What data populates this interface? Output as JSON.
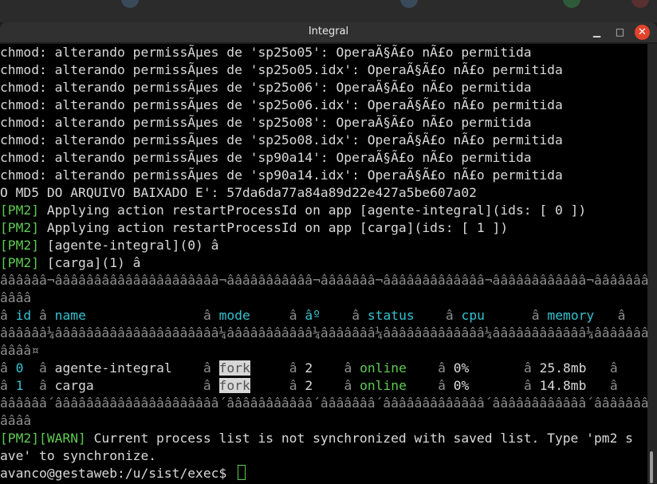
{
  "window": {
    "title": "Integral",
    "minimize": "▁",
    "maximize": "□",
    "close": "✕"
  },
  "chmod_lines": [
    "chmod: alterando permissÃµes de 'sp25o05': OperaÃ§Ã£o nÃ£o permitida",
    "chmod: alterando permissÃµes de 'sp25o05.idx': OperaÃ§Ã£o nÃ£o permitida",
    "chmod: alterando permissÃµes de 'sp25o06': OperaÃ§Ã£o nÃ£o permitida",
    "chmod: alterando permissÃµes de 'sp25o06.idx': OperaÃ§Ã£o nÃ£o permitida",
    "chmod: alterando permissÃµes de 'sp25o08': OperaÃ§Ã£o nÃ£o permitida",
    "chmod: alterando permissÃµes de 'sp25o08.idx': OperaÃ§Ã£o nÃ£o permitida",
    "chmod: alterando permissÃµes de 'sp90a14': OperaÃ§Ã£o nÃ£o permitida",
    "chmod: alterando permissÃµes de 'sp90a14.idx': OperaÃ§Ã£o nÃ£o permitida"
  ],
  "md5_line": "O MD5 DO ARQUIVO BAIXADO E': 57da6da77a84a89d22e427a5be607a02",
  "pm2_tag": "[PM2]",
  "pm2_lines": [
    " Applying action restartProcessId on app [agente-integral](ids: [ 0 ])",
    " Applying action restartProcessId on app [carga](ids: [ 1 ])",
    " [agente-integral](0) â",
    " [carga](1) â"
  ],
  "table": {
    "top_border": "ââââââ¬âââââââââââââââââââââ¬âââââââââââ¬âââââââ¬âââââââââââââ¬ââââââââââââ¬ââââââââ",
    "top_border_2": "ââââ",
    "sep": "â",
    "header": {
      "id": "id",
      "name": "name",
      "mode": "mode",
      "restarts": "âº",
      "status": "status",
      "cpu": "cpu",
      "memory": "memory"
    },
    "mid_border": "ââââââ¼âââââââââââââââââââââ¼âââââââââââ¼âââââââ¼âââââââââââââ¼ââââââââââââ¼ââââââââ",
    "mid_border_2": "ââââ¤",
    "rows": [
      {
        "id": "0",
        "name": "agente-integral",
        "mode": "fork",
        "restarts": "2",
        "status": "online",
        "cpu": "0%",
        "memory": "25.8mb"
      },
      {
        "id": "1",
        "name": "carga",
        "mode": "fork",
        "restarts": "2",
        "status": "online",
        "cpu": "0%",
        "memory": "14.8mb"
      }
    ],
    "bottom_border": "ââââââ´âââââââââââââââââââââ´âââââââââââ´âââââââ´âââââââââââââ´ââââââââââââ´ââââââââ",
    "bottom_border_2": "ââââ"
  },
  "warn": {
    "tag": "[PM2][WARN]",
    "text": " Current process list is not synchronized with saved list. Type 'pm2 s",
    "text_2": "ave' to synchronize."
  },
  "prompt": "avanco@gestaweb:/u/sist/exec$ ",
  "colors": {
    "green": "#5ecb52",
    "cyan": "#34c0cf",
    "close": "#e2432c",
    "terminal_bg": "#000000"
  }
}
